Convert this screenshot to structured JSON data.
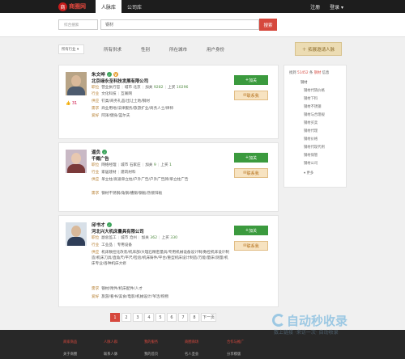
{
  "header": {
    "logo_text": "商圈网",
    "logo_sub": "SHANGQUAN.COM",
    "tabs": [
      "人脉库",
      "公司库"
    ],
    "login": "注册",
    "register": "登录 ▾"
  },
  "search": {
    "type_label": "综合搜索",
    "value": "钢材",
    "button": "搜索"
  },
  "filters": {
    "industry": "所有行业 ▾",
    "items": [
      "所有供求",
      "性别",
      "所在城市",
      "用户身份"
    ],
    "invite": "拓展邀请人脉"
  },
  "cards": [
    {
      "name": "朱文哗",
      "company": "北京绿永圣科技发展有限公司",
      "likes": "31",
      "rows": [
        {
          "k": "职位",
          "parts": [
            "营业执行官",
            "城市",
            "北京",
            "加关",
            "9282",
            "上买",
            "10296"
          ]
        },
        {
          "k": "行业",
          "parts": [
            "文化科技",
            "互联网"
          ]
        },
        {
          "k": "供应",
          "text": "钉类/商务礼品/出让土地/钢材"
        },
        {
          "k": "需求",
          "text": "商业用地/法律服务/旅游扩业/商务人士/律师"
        },
        {
          "k": "爱好",
          "text": "阿泽/健身/篮尔夫"
        }
      ],
      "add": "加关",
      "contact": "联系我"
    },
    {
      "name": "逼负",
      "company": "千概广告",
      "rows": [
        {
          "k": "职位",
          "parts": [
            "网络经理",
            "城市",
            "石家庄",
            "加关",
            "9",
            "上买",
            "1"
          ]
        },
        {
          "k": "行业",
          "parts": [
            "家居建材",
            "建筑材料"
          ]
        },
        {
          "k": "供应",
          "text": "单立柱/高速单立柱/户外广告/户外广告牌/单立柱广告"
        },
        {
          "k": "需求",
          "text": "钢材不锈钢/角钢/槽钢/钢板/热镀锌板"
        }
      ],
      "add": "加关",
      "contact": "联系我"
    },
    {
      "name": "邱书才",
      "company": "河北兴大机床量具有限公司",
      "rows": [
        {
          "k": "职位",
          "parts": [
            "副总监工",
            "城市",
            "沧州",
            "加关",
            "362",
            "上买",
            "330"
          ]
        },
        {
          "k": "行业",
          "parts": [
            "工业品",
            "专用设备"
          ]
        },
        {
          "k": "供应",
          "text": "机床数控化改装/机床部/大理石精密量具/专用机械设备设计制/数控机床设计制造/机床刀具/直角尺/平尺/检验/机床铸件/平台/重型机床设计制造/万能/量床/测量/机床专业/各种机床大修"
        },
        {
          "k": "需求",
          "text": "钢材/附件/机床配件/人才"
        },
        {
          "k": "爱好",
          "text": "旅游/看书/美食/电影/机械设计/爷活/购物"
        }
      ],
      "add": "加关",
      "contact": "联系我"
    }
  ],
  "sidebar": {
    "head_a": "找到",
    "count": "51452",
    "head_b": "条",
    "head_c": "钢材",
    "head_d": "信息",
    "category": "钢材",
    "items": [
      "钢材代销价格",
      "钢材下料",
      "钢材不锈钢",
      "钢材与合理规",
      "钢材买卖",
      "钢材代理",
      "钢材价格",
      "钢材代现代例",
      "钢材保管",
      "钢材公司"
    ],
    "more": "▾ 更多"
  },
  "pagination": [
    "1",
    "2",
    "3",
    "4",
    "5",
    "6",
    "7",
    "8",
    "下一页"
  ],
  "footer": {
    "cols": [
      "商家商品",
      "人脉人群",
      "我的服务",
      "商圈商场",
      "合作与推广"
    ],
    "subs": [
      "关于商圈",
      "联系人脉",
      "我的首页",
      "名人圣会",
      "分享模版"
    ]
  },
  "watermark": {
    "text": "自动秒收录",
    "sub": "数上链接 ·来访一次· 自动收录"
  }
}
